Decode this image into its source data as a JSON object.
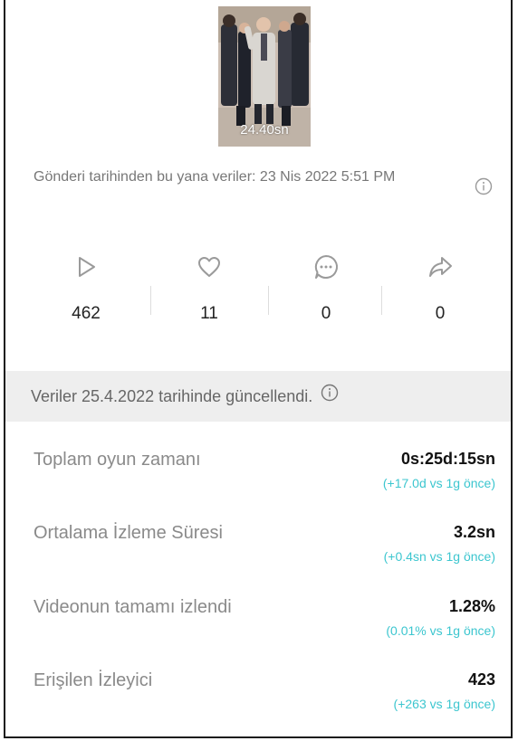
{
  "video": {
    "duration": "24.40sn"
  },
  "posted_since": "Gönderi tarihinden bu yana veriler: 23 Nis 2022 5:51 PM",
  "stats": [
    {
      "icon": "play-icon",
      "value": "462"
    },
    {
      "icon": "heart-icon",
      "value": "11"
    },
    {
      "icon": "comment-icon",
      "value": "0"
    },
    {
      "icon": "share-icon",
      "value": "0"
    }
  ],
  "updated_text": "Veriler 25.4.2022 tarihinde güncellendi.",
  "metrics": [
    {
      "label": "Toplam oyun zamanı",
      "value": "0s:25d:15sn",
      "delta": "(+17.0d vs 1g önce)"
    },
    {
      "label": "Ortalama İzleme Süresi",
      "value": "3.2sn",
      "delta": "(+0.4sn vs 1g önce)"
    },
    {
      "label": "Videonun tamamı izlendi",
      "value": "1.28%",
      "delta": "(0.01% vs 1g önce)"
    },
    {
      "label": "Erişilen İzleyici",
      "value": "423",
      "delta": "(+263 vs 1g önce)"
    }
  ],
  "colors": {
    "accent_delta": "#3cc6cf",
    "icon_gray": "#9a9a9a",
    "bar_bg": "#eeeeee"
  }
}
